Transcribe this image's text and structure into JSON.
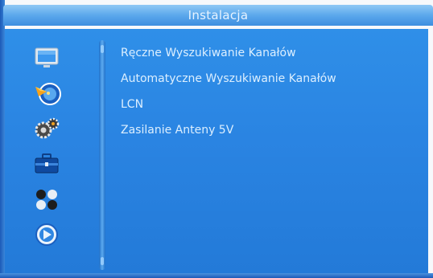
{
  "window": {
    "title": "Instalacja"
  },
  "sidebar": {
    "icons": [
      {
        "name": "tv-icon"
      },
      {
        "name": "satellite-dish-icon",
        "selected": true
      },
      {
        "name": "settings-gear-icon"
      },
      {
        "name": "toolbox-icon"
      },
      {
        "name": "media-dots-icon"
      },
      {
        "name": "disc-icon"
      }
    ]
  },
  "menu": {
    "items": [
      {
        "label": "Ręczne Wyszukiwanie Kanałów"
      },
      {
        "label": "Automatyczne Wyszukiwanie Kanałów"
      },
      {
        "label": "LCN"
      },
      {
        "label": "Zasilanie Anteny 5V"
      }
    ]
  },
  "theme": {
    "panel_blue": "#2a84e2",
    "title_blue": "#5ba8ec",
    "text": "#dcefff"
  }
}
